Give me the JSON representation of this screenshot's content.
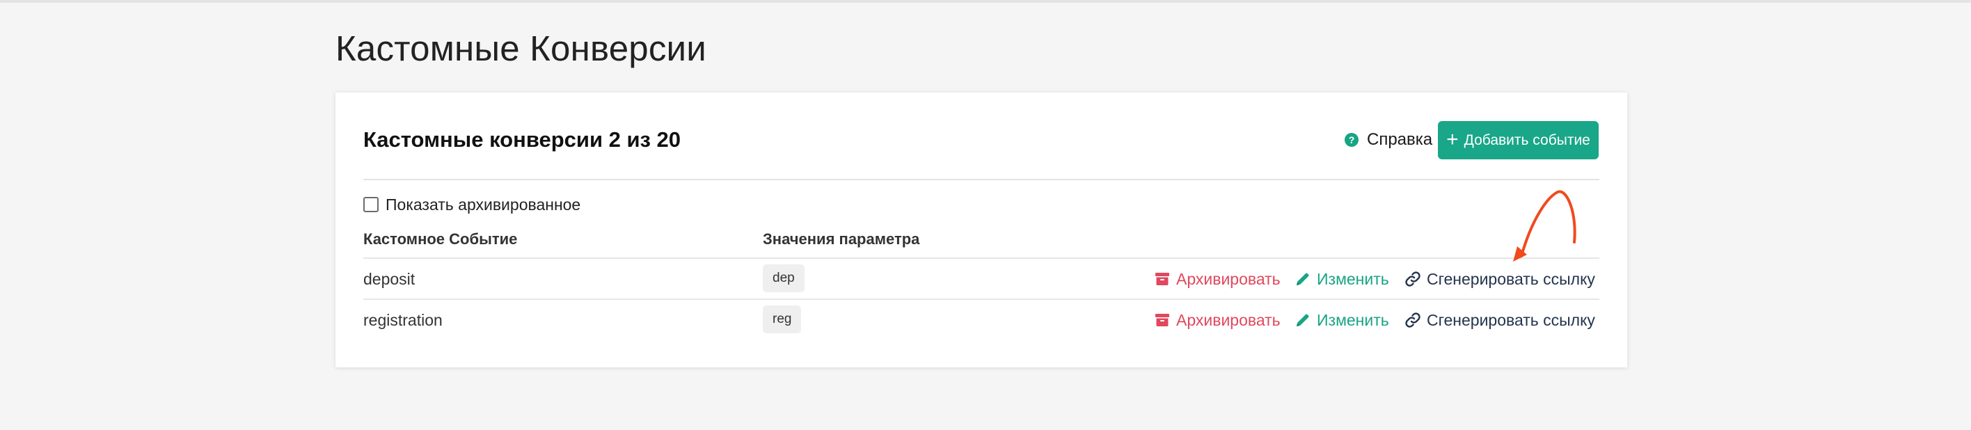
{
  "page": {
    "title": "Кастомные Конверсии"
  },
  "card": {
    "title": "Кастомные конверсии 2 из 20",
    "help_label": "Справка",
    "add_button_label": "Добавить событие",
    "show_archived_label": "Показать архивированное",
    "show_archived_checked": false
  },
  "table": {
    "headers": {
      "event": "Кастомное Событие",
      "params": "Значения параметра"
    },
    "rows": [
      {
        "event": "deposit",
        "param": "dep"
      },
      {
        "event": "registration",
        "param": "reg"
      }
    ]
  },
  "actions": {
    "archive_label": "Архивировать",
    "edit_label": "Изменить",
    "link_label": "Сгенерировать ссылку"
  },
  "icons": {
    "help": "question-circle-icon",
    "add": "plus-icon",
    "archive": "archive-box-icon",
    "edit": "pencil-icon",
    "link": "chain-link-icon",
    "annotation": "red-arrow-annotation"
  },
  "colors": {
    "accent": "#19a689",
    "danger": "#e0485d",
    "link": "#23344d",
    "annotation": "#f04a1e"
  }
}
